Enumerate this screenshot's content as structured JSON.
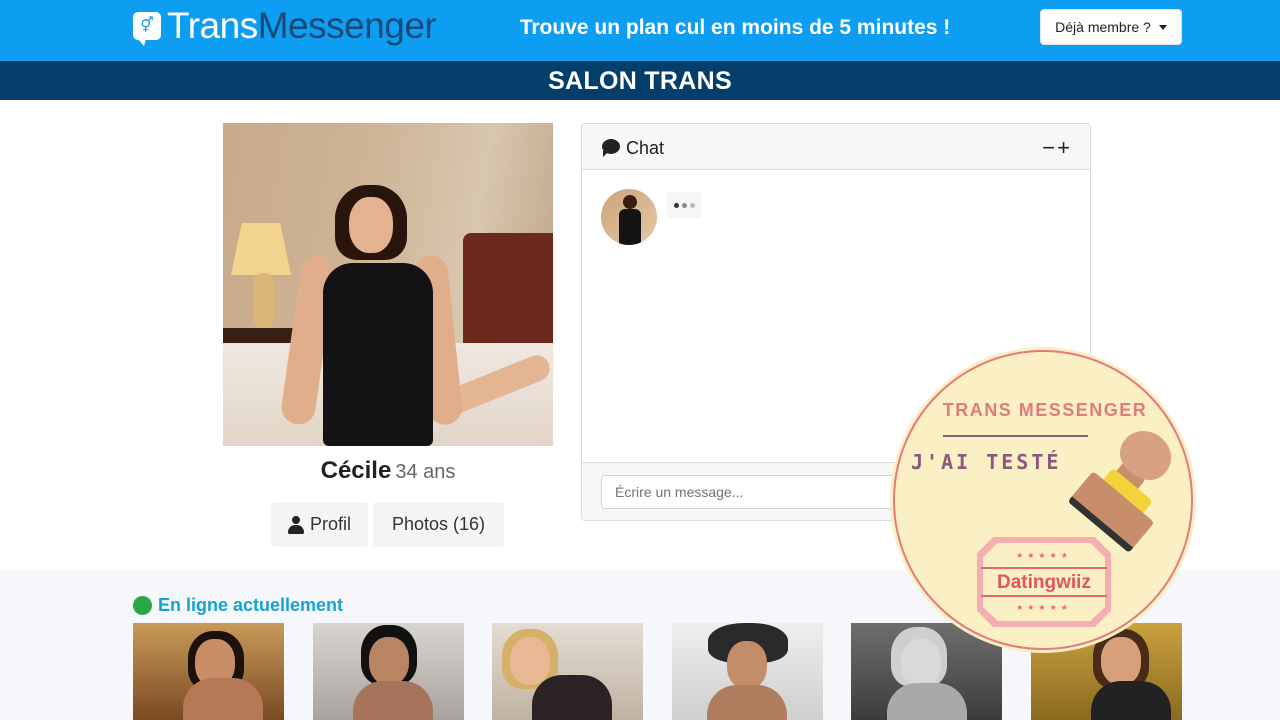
{
  "header": {
    "logo_trans": "Trans",
    "logo_messenger": "Messenger",
    "tagline": "Trouve un plan cul en moins de 5 minutes !",
    "member_button": "Déjà membre ?",
    "brand_color": "#0d9ef2"
  },
  "salon": {
    "title": "SALON TRANS"
  },
  "profile": {
    "name": "Cécile",
    "age": "34 ans",
    "profil_button": "Profil",
    "photos_button": "Photos (16)"
  },
  "chat": {
    "title": "Chat",
    "minimize": "−",
    "expand": "+",
    "input_placeholder": "Écrire un message...",
    "typing_dot_colors": [
      "#333333",
      "#888888",
      "#bbbbbb"
    ]
  },
  "online": {
    "title": "En ligne actuellement",
    "status_color": "#28a745"
  },
  "stamp": {
    "title": "TRANS MESSENGER",
    "subtitle": "J'AI TESTÉ",
    "badge_text": "Datingwiiz"
  }
}
